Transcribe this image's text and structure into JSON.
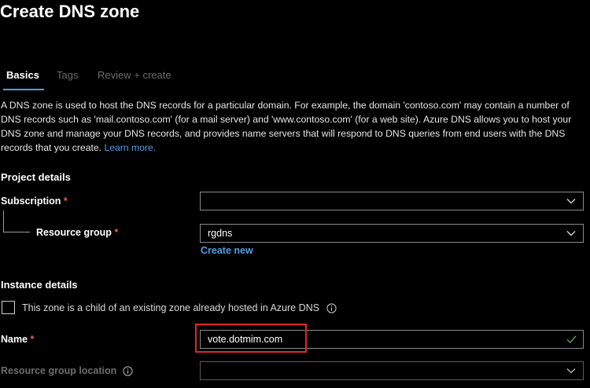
{
  "page": {
    "title": "Create DNS zone"
  },
  "tabs": [
    {
      "label": "Basics",
      "active": true
    },
    {
      "label": "Tags",
      "active": false
    },
    {
      "label": "Review + create",
      "active": false
    }
  ],
  "description": {
    "text": "A DNS zone is used to host the DNS records for a particular domain. For example, the domain 'contoso.com' may contain a number of DNS records such as 'mail.contoso.com' (for a mail server) and 'www.contoso.com' (for a web site). Azure DNS allows you to host your DNS zone and manage your DNS records, and provides name servers that will respond to DNS queries from end users with the DNS records that you create.",
    "learn_more": "Learn more."
  },
  "project_details": {
    "heading": "Project details",
    "subscription": {
      "label": "Subscription",
      "required": "*",
      "value": ""
    },
    "resource_group": {
      "label": "Resource group",
      "required": "*",
      "value": "rgdns",
      "create_new": "Create new"
    }
  },
  "instance_details": {
    "heading": "Instance details",
    "child_zone": {
      "label": "This zone is a child of an existing zone already hosted in Azure DNS",
      "checked": false
    },
    "name": {
      "label": "Name",
      "required": "*",
      "value": "vote.dotmim.com",
      "valid": true
    },
    "location": {
      "label": "Resource group location",
      "value": ""
    }
  },
  "colors": {
    "accent": "#4f9fe6",
    "required": "#e15a5a",
    "valid_check": "#57a64a",
    "highlight": "#e0262b",
    "background": "#000000"
  }
}
